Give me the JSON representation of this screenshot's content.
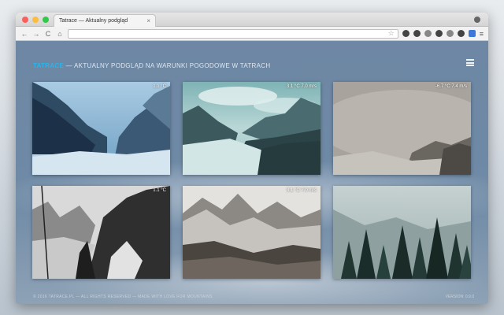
{
  "browser": {
    "tab_title": "Tatrace — Aktualny podgląd",
    "tab_close": "×",
    "url": "",
    "colors": {
      "close": "#fc605c",
      "minimize": "#fdbc40",
      "maximize": "#34c84a"
    }
  },
  "header": {
    "brand": "TATRACE",
    "tagline": " — AKTUALNY PODGLĄD NA WARUNKI POGODOWE W TATRACH",
    "brand_color": "#2db3e8"
  },
  "cameras": [
    {
      "temp": "1.1 °C",
      "stamp_left": "",
      "stamp_right": ""
    },
    {
      "temp": "3.1 °C   7.0 m/s",
      "stamp_left": "",
      "stamp_right": ""
    },
    {
      "temp": "-6.7 °C   7.4 m/s",
      "stamp_left": "",
      "stamp_right": ""
    },
    {
      "temp": "1.1 °C",
      "stamp_left": "",
      "stamp_right": ""
    },
    {
      "temp": "3.1 °C   7.0 m/s",
      "stamp_left": "",
      "stamp_right": ""
    },
    {
      "temp": "",
      "stamp_left": "",
      "stamp_right": ""
    }
  ],
  "footer": {
    "left": "© 2016 TATRACE.PL — ALL RIGHTS RESERVED — MADE WITH LOVE FOR MOUNTAINS",
    "right": "VERSION: 0.9.0"
  }
}
